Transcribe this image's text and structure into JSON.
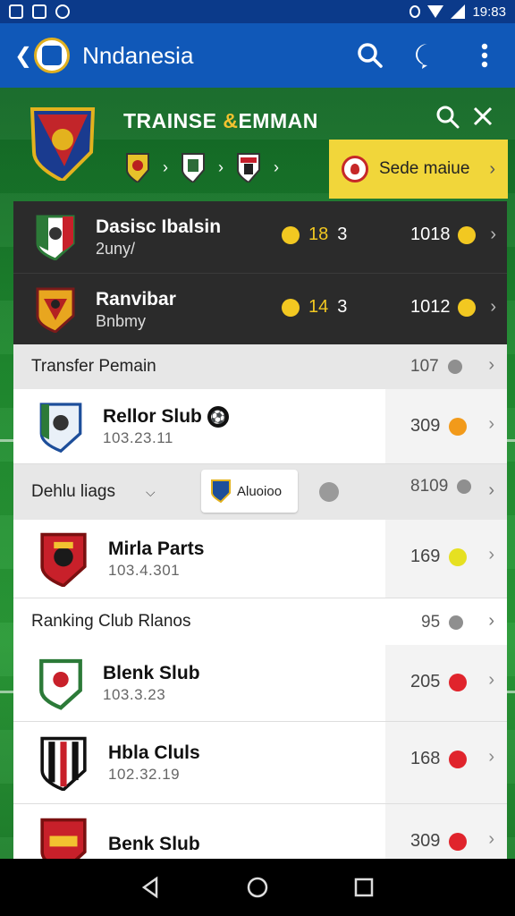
{
  "status_bar": {
    "time": "19:83"
  },
  "app_bar": {
    "title": "Nndanesia"
  },
  "hero": {
    "title_part1": "TRAINSE ",
    "title_amp": "&",
    "title_part2": "EMMAN",
    "cta_label": "Sede maiue"
  },
  "dark_rows": [
    {
      "name": "Dasisc Ibalsin",
      "sub": "2uny/",
      "stat_value": "18",
      "stat_count": "3",
      "right_value": "1018"
    },
    {
      "name": "Ranvibar",
      "sub": "Bnbmy",
      "stat_value": "14",
      "stat_count": "3",
      "right_value": "1012"
    }
  ],
  "transfer_section": {
    "label": "Transfer Pemain",
    "value": "107"
  },
  "club_rows": [
    {
      "name": "Rellor Slub",
      "sub": "103.23.11",
      "value": "309",
      "coin": "orange"
    },
    {
      "name": "Mirla Parts",
      "sub": "103.4.301",
      "value": "169",
      "coin": "lime"
    },
    {
      "name": "Blenk Slub",
      "sub": "103.3.23",
      "value": "205",
      "coin": "red"
    },
    {
      "name": "Hbla Cluls",
      "sub": "102.32.19",
      "value": "168",
      "coin": "red"
    },
    {
      "name": "Benk Slub",
      "sub": "",
      "value": "309",
      "coin": "red"
    }
  ],
  "filter": {
    "label": "Dehlu liags",
    "chip_label": "Aluoioo",
    "value": "8109"
  },
  "ranking": {
    "label": "Ranking Club  Rlanos",
    "value": "95"
  }
}
